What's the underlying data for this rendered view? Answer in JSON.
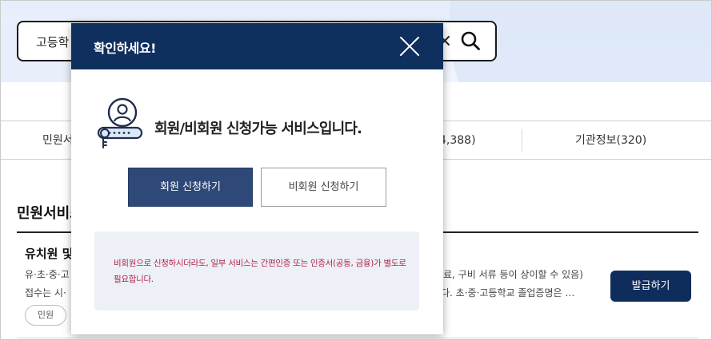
{
  "search": {
    "query": "고등학",
    "clear_icon": "close-small-icon",
    "search_icon": "magnifier-icon"
  },
  "tabs": {
    "tab1_label": "민원서",
    "tab3_label": "4,388)",
    "tab4_label": "기관정보(320)"
  },
  "section": {
    "title": "민원서비스",
    "item": {
      "title": "유치원 및",
      "desc_line1": "유·초·중·고",
      "desc_line1_tail": "료, 구비 서류 등이 상이할 수 있음)",
      "desc_line2": "접수는 시·",
      "desc_line2_tail": "다. 초·중·고등학교 졸업증명은 …",
      "tag": "민원",
      "issue_button": "발급하기"
    }
  },
  "modal": {
    "title": "확인하세요!",
    "close_icon": "close-icon",
    "member_icon": "member-login-icon",
    "message": "회원/비회원 신청가능 서비스입니다.",
    "member_button": "회원 신청하기",
    "nonmember_button": "비회원 신청하기",
    "notice": "비회원으로 신청하시더라도, 일부 서비스는 간편인증 또는 인증서(공동, 금융)가 별도로 필요합니다."
  },
  "colors": {
    "modal_header": "#0f2f5e",
    "primary_button": "#2e4878",
    "issue_button": "#0f2d5c",
    "notice_text": "#b2224a",
    "notice_bg": "#edf1f7"
  }
}
